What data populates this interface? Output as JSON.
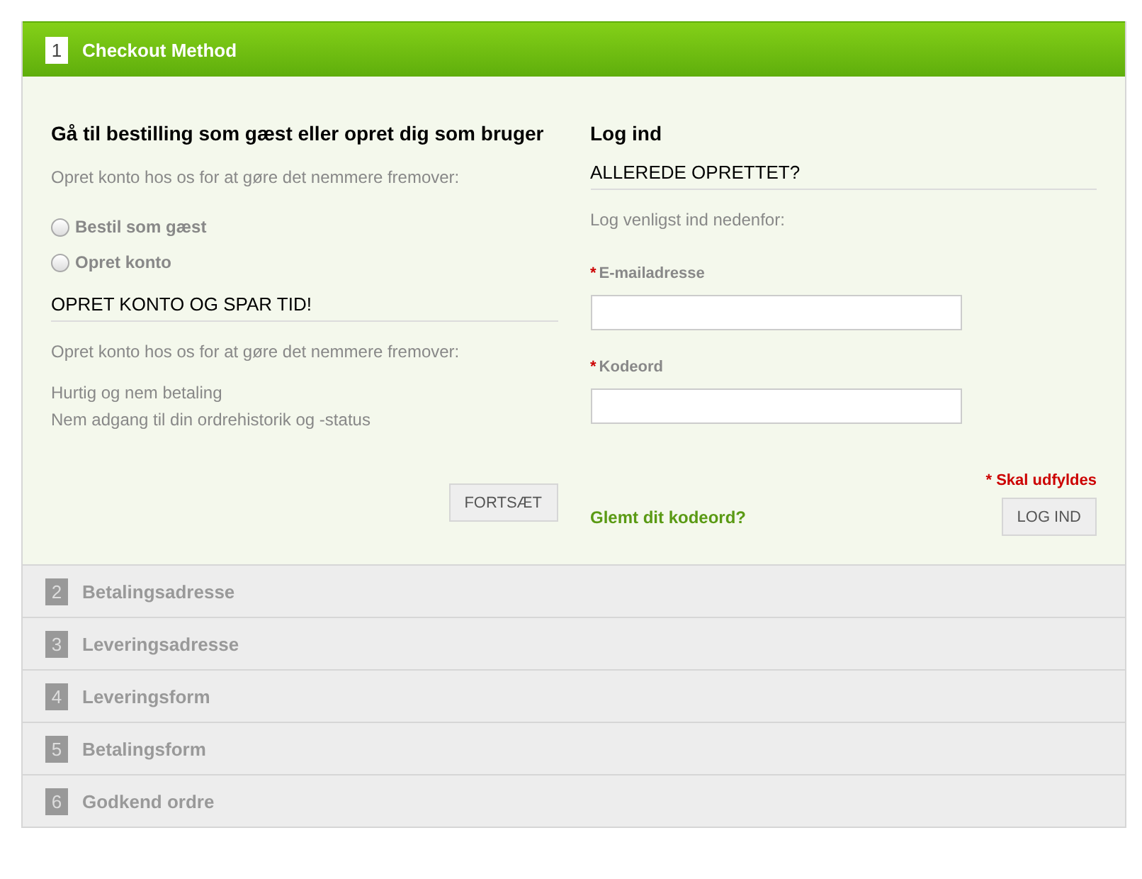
{
  "steps": [
    {
      "number": "1",
      "title": "Checkout Method",
      "selected": true
    },
    {
      "number": "2",
      "title": "Betalingsadresse",
      "selected": false
    },
    {
      "number": "3",
      "title": "Leveringsadresse",
      "selected": false
    },
    {
      "number": "4",
      "title": "Leveringsform",
      "selected": false
    },
    {
      "number": "5",
      "title": "Betalingsform",
      "selected": false
    },
    {
      "number": "6",
      "title": "Godkend ordre",
      "selected": false
    }
  ],
  "guest": {
    "title": "Gå til bestilling som gæst eller opret dig som bruger",
    "intro": "Opret konto hos os for at gøre det nemmere fremover:",
    "options": [
      {
        "label": "Bestil som gæst",
        "selected": false
      },
      {
        "label": "Opret konto",
        "selected": false
      }
    ],
    "section_title": "OPRET KONTO OG SPAR TID!",
    "section_intro": "Opret konto hos os for at gøre det nemmere fremover:",
    "benefits": [
      "Hurtig og nem betaling",
      "Nem adgang til din ordrehistorik og -status"
    ],
    "button": "FORTSÆT"
  },
  "login": {
    "title": "Log ind",
    "section_title": "ALLEREDE OPRETTET?",
    "intro": "Log venligst ind nedenfor:",
    "fields": [
      {
        "marker": "*",
        "label": "E-mailadresse"
      },
      {
        "marker": "*",
        "label": "Kodeord"
      }
    ],
    "required_note": "* Skal udfyldes",
    "forgot_link": "Glemt dit kodeord?",
    "button": "LOG IND"
  }
}
